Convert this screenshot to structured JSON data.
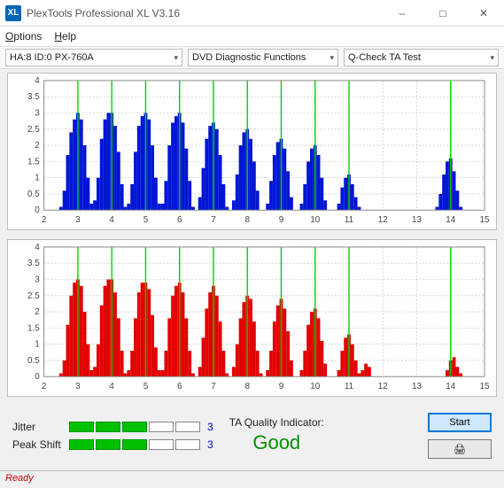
{
  "titlebar": {
    "icon_text": "XL",
    "title": "PlexTools Professional XL V3.16"
  },
  "menubar": {
    "options": "Options",
    "help": "Help"
  },
  "toolbar": {
    "device": "HA:8 ID:0   PX-760A",
    "category": "DVD Diagnostic Functions",
    "test": "Q-Check TA Test"
  },
  "chart_data": [
    {
      "type": "bar",
      "color": "#0015d6",
      "xlim": [
        2,
        15
      ],
      "ylim": [
        0,
        4
      ],
      "xticks": [
        2,
        3,
        4,
        5,
        6,
        7,
        8,
        9,
        10,
        11,
        12,
        13,
        14,
        15
      ],
      "yticks": [
        0,
        0.5,
        1,
        1.5,
        2,
        2.5,
        3,
        3.5,
        4
      ],
      "greenlines": [
        3,
        4,
        5,
        6,
        7,
        8,
        9,
        10,
        11,
        14
      ],
      "dx": 0.1,
      "series": [
        {
          "x": 2.5,
          "y": 0.1
        },
        {
          "x": 2.6,
          "y": 0.6
        },
        {
          "x": 2.7,
          "y": 1.7
        },
        {
          "x": 2.8,
          "y": 2.4
        },
        {
          "x": 2.9,
          "y": 2.8
        },
        {
          "x": 3.0,
          "y": 3.0
        },
        {
          "x": 3.1,
          "y": 2.8
        },
        {
          "x": 3.2,
          "y": 2.0
        },
        {
          "x": 3.3,
          "y": 1.0
        },
        {
          "x": 3.4,
          "y": 0.2
        },
        {
          "x": 3.5,
          "y": 0.3
        },
        {
          "x": 3.6,
          "y": 1.0
        },
        {
          "x": 3.7,
          "y": 2.2
        },
        {
          "x": 3.8,
          "y": 2.8
        },
        {
          "x": 3.9,
          "y": 3.0
        },
        {
          "x": 4.0,
          "y": 3.0
        },
        {
          "x": 4.1,
          "y": 2.6
        },
        {
          "x": 4.2,
          "y": 1.8
        },
        {
          "x": 4.3,
          "y": 0.8
        },
        {
          "x": 4.4,
          "y": 0.1
        },
        {
          "x": 4.5,
          "y": 0.2
        },
        {
          "x": 4.6,
          "y": 0.8
        },
        {
          "x": 4.7,
          "y": 1.8
        },
        {
          "x": 4.8,
          "y": 2.6
        },
        {
          "x": 4.9,
          "y": 2.9
        },
        {
          "x": 5.0,
          "y": 3.0
        },
        {
          "x": 5.1,
          "y": 2.8
        },
        {
          "x": 5.2,
          "y": 2.0
        },
        {
          "x": 5.3,
          "y": 1.0
        },
        {
          "x": 5.4,
          "y": 0.2
        },
        {
          "x": 5.5,
          "y": 0.2
        },
        {
          "x": 5.6,
          "y": 0.9
        },
        {
          "x": 5.7,
          "y": 2.0
        },
        {
          "x": 5.8,
          "y": 2.7
        },
        {
          "x": 5.9,
          "y": 2.9
        },
        {
          "x": 6.0,
          "y": 3.0
        },
        {
          "x": 6.1,
          "y": 2.7
        },
        {
          "x": 6.2,
          "y": 1.9
        },
        {
          "x": 6.3,
          "y": 0.9
        },
        {
          "x": 6.4,
          "y": 0.1
        },
        {
          "x": 6.6,
          "y": 0.4
        },
        {
          "x": 6.7,
          "y": 1.3
        },
        {
          "x": 6.8,
          "y": 2.2
        },
        {
          "x": 6.9,
          "y": 2.6
        },
        {
          "x": 7.0,
          "y": 2.7
        },
        {
          "x": 7.1,
          "y": 2.5
        },
        {
          "x": 7.2,
          "y": 1.7
        },
        {
          "x": 7.3,
          "y": 0.8
        },
        {
          "x": 7.4,
          "y": 0.1
        },
        {
          "x": 7.6,
          "y": 0.3
        },
        {
          "x": 7.7,
          "y": 1.1
        },
        {
          "x": 7.8,
          "y": 2.0
        },
        {
          "x": 7.9,
          "y": 2.4
        },
        {
          "x": 8.0,
          "y": 2.5
        },
        {
          "x": 8.1,
          "y": 2.2
        },
        {
          "x": 8.2,
          "y": 1.5
        },
        {
          "x": 8.3,
          "y": 0.6
        },
        {
          "x": 8.6,
          "y": 0.2
        },
        {
          "x": 8.7,
          "y": 0.9
        },
        {
          "x": 8.8,
          "y": 1.7
        },
        {
          "x": 8.9,
          "y": 2.1
        },
        {
          "x": 9.0,
          "y": 2.2
        },
        {
          "x": 9.1,
          "y": 1.9
        },
        {
          "x": 9.2,
          "y": 1.2
        },
        {
          "x": 9.3,
          "y": 0.4
        },
        {
          "x": 9.6,
          "y": 0.2
        },
        {
          "x": 9.7,
          "y": 0.8
        },
        {
          "x": 9.8,
          "y": 1.5
        },
        {
          "x": 9.9,
          "y": 1.9
        },
        {
          "x": 10.0,
          "y": 2.0
        },
        {
          "x": 10.1,
          "y": 1.7
        },
        {
          "x": 10.2,
          "y": 1.0
        },
        {
          "x": 10.3,
          "y": 0.3
        },
        {
          "x": 10.7,
          "y": 0.2
        },
        {
          "x": 10.8,
          "y": 0.7
        },
        {
          "x": 10.9,
          "y": 1.0
        },
        {
          "x": 11.0,
          "y": 1.1
        },
        {
          "x": 11.1,
          "y": 0.8
        },
        {
          "x": 11.2,
          "y": 0.4
        },
        {
          "x": 11.3,
          "y": 0.1
        },
        {
          "x": 13.6,
          "y": 0.1
        },
        {
          "x": 13.7,
          "y": 0.5
        },
        {
          "x": 13.8,
          "y": 1.1
        },
        {
          "x": 13.9,
          "y": 1.5
        },
        {
          "x": 14.0,
          "y": 1.6
        },
        {
          "x": 14.1,
          "y": 1.2
        },
        {
          "x": 14.2,
          "y": 0.6
        },
        {
          "x": 14.3,
          "y": 0.1
        }
      ]
    },
    {
      "type": "bar",
      "color": "#e30000",
      "xlim": [
        2,
        15
      ],
      "ylim": [
        0,
        4
      ],
      "xticks": [
        2,
        3,
        4,
        5,
        6,
        7,
        8,
        9,
        10,
        11,
        12,
        13,
        14,
        15
      ],
      "yticks": [
        0,
        0.5,
        1,
        1.5,
        2,
        2.5,
        3,
        3.5,
        4
      ],
      "greenlines": [
        3,
        4,
        5,
        6,
        7,
        8,
        9,
        10,
        11,
        14
      ],
      "dx": 0.1,
      "series": [
        {
          "x": 2.5,
          "y": 0.1
        },
        {
          "x": 2.6,
          "y": 0.5
        },
        {
          "x": 2.7,
          "y": 1.6
        },
        {
          "x": 2.8,
          "y": 2.5
        },
        {
          "x": 2.9,
          "y": 2.9
        },
        {
          "x": 3.0,
          "y": 3.0
        },
        {
          "x": 3.1,
          "y": 2.8
        },
        {
          "x": 3.2,
          "y": 2.0
        },
        {
          "x": 3.3,
          "y": 1.0
        },
        {
          "x": 3.4,
          "y": 0.2
        },
        {
          "x": 3.5,
          "y": 0.3
        },
        {
          "x": 3.6,
          "y": 1.0
        },
        {
          "x": 3.7,
          "y": 2.2
        },
        {
          "x": 3.8,
          "y": 2.8
        },
        {
          "x": 3.9,
          "y": 3.0
        },
        {
          "x": 4.0,
          "y": 3.0
        },
        {
          "x": 4.1,
          "y": 2.6
        },
        {
          "x": 4.2,
          "y": 1.8
        },
        {
          "x": 4.3,
          "y": 0.8
        },
        {
          "x": 4.4,
          "y": 0.1
        },
        {
          "x": 4.5,
          "y": 0.2
        },
        {
          "x": 4.6,
          "y": 0.8
        },
        {
          "x": 4.7,
          "y": 1.8
        },
        {
          "x": 4.8,
          "y": 2.6
        },
        {
          "x": 4.9,
          "y": 2.9
        },
        {
          "x": 5.0,
          "y": 2.9
        },
        {
          "x": 5.1,
          "y": 2.7
        },
        {
          "x": 5.2,
          "y": 1.9
        },
        {
          "x": 5.3,
          "y": 0.9
        },
        {
          "x": 5.4,
          "y": 0.2
        },
        {
          "x": 5.5,
          "y": 0.2
        },
        {
          "x": 5.6,
          "y": 0.8
        },
        {
          "x": 5.7,
          "y": 1.8
        },
        {
          "x": 5.8,
          "y": 2.5
        },
        {
          "x": 5.9,
          "y": 2.8
        },
        {
          "x": 6.0,
          "y": 2.9
        },
        {
          "x": 6.1,
          "y": 2.6
        },
        {
          "x": 6.2,
          "y": 1.8
        },
        {
          "x": 6.3,
          "y": 0.8
        },
        {
          "x": 6.4,
          "y": 0.1
        },
        {
          "x": 6.6,
          "y": 0.3
        },
        {
          "x": 6.7,
          "y": 1.2
        },
        {
          "x": 6.8,
          "y": 2.1
        },
        {
          "x": 6.9,
          "y": 2.6
        },
        {
          "x": 7.0,
          "y": 2.8
        },
        {
          "x": 7.1,
          "y": 2.5
        },
        {
          "x": 7.2,
          "y": 1.7
        },
        {
          "x": 7.3,
          "y": 0.8
        },
        {
          "x": 7.4,
          "y": 0.1
        },
        {
          "x": 7.6,
          "y": 0.3
        },
        {
          "x": 7.7,
          "y": 1.0
        },
        {
          "x": 7.8,
          "y": 1.8
        },
        {
          "x": 7.9,
          "y": 2.3
        },
        {
          "x": 8.0,
          "y": 2.5
        },
        {
          "x": 8.1,
          "y": 2.4
        },
        {
          "x": 8.2,
          "y": 1.7
        },
        {
          "x": 8.3,
          "y": 0.8
        },
        {
          "x": 8.4,
          "y": 0.1
        },
        {
          "x": 8.6,
          "y": 0.2
        },
        {
          "x": 8.7,
          "y": 0.8
        },
        {
          "x": 8.8,
          "y": 1.7
        },
        {
          "x": 8.9,
          "y": 2.2
        },
        {
          "x": 9.0,
          "y": 2.4
        },
        {
          "x": 9.1,
          "y": 2.1
        },
        {
          "x": 9.2,
          "y": 1.4
        },
        {
          "x": 9.3,
          "y": 0.5
        },
        {
          "x": 9.6,
          "y": 0.2
        },
        {
          "x": 9.7,
          "y": 0.8
        },
        {
          "x": 9.8,
          "y": 1.6
        },
        {
          "x": 9.9,
          "y": 2.0
        },
        {
          "x": 10.0,
          "y": 2.1
        },
        {
          "x": 10.1,
          "y": 1.8
        },
        {
          "x": 10.2,
          "y": 1.1
        },
        {
          "x": 10.3,
          "y": 0.4
        },
        {
          "x": 10.7,
          "y": 0.2
        },
        {
          "x": 10.8,
          "y": 0.8
        },
        {
          "x": 10.9,
          "y": 1.2
        },
        {
          "x": 11.0,
          "y": 1.3
        },
        {
          "x": 11.1,
          "y": 1.0
        },
        {
          "x": 11.2,
          "y": 0.5
        },
        {
          "x": 11.3,
          "y": 0.1
        },
        {
          "x": 11.4,
          "y": 0.2
        },
        {
          "x": 11.5,
          "y": 0.4
        },
        {
          "x": 11.6,
          "y": 0.3
        },
        {
          "x": 13.9,
          "y": 0.2
        },
        {
          "x": 14.0,
          "y": 0.5
        },
        {
          "x": 14.1,
          "y": 0.6
        },
        {
          "x": 14.2,
          "y": 0.3
        },
        {
          "x": 14.3,
          "y": 0.1
        }
      ]
    }
  ],
  "bottom": {
    "jitter_label": "Jitter",
    "jitter_value": "3",
    "jitter_segments": 3,
    "jitter_total": 5,
    "peak_label": "Peak Shift",
    "peak_value": "3",
    "peak_segments": 3,
    "peak_total": 5,
    "ta_label": "TA Quality Indicator:",
    "ta_value": "Good",
    "start_btn": "Start",
    "print_btn": "🖨"
  },
  "statusbar": {
    "text": "Ready"
  }
}
